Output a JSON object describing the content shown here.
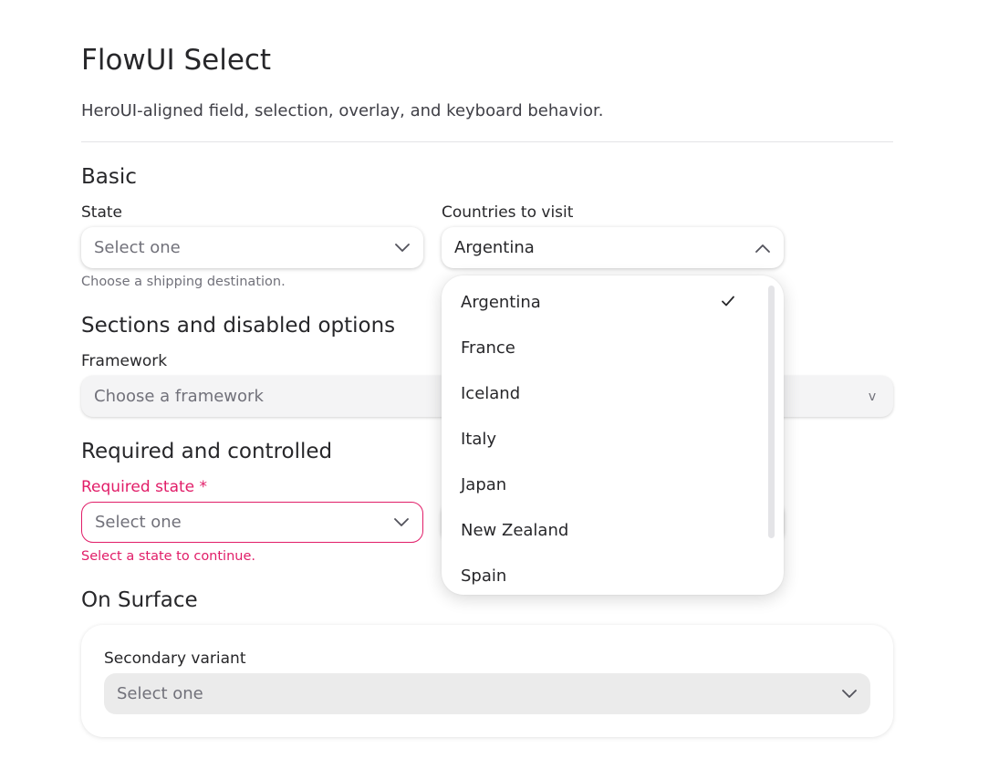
{
  "page": {
    "title": "FlowUI Select",
    "description": "HeroUI-aligned field, selection, overlay, and keyboard behavior."
  },
  "basic": {
    "heading": "Basic",
    "state": {
      "label": "State",
      "placeholder": "Select one",
      "help": "Choose a shipping destination."
    },
    "countries": {
      "label": "Countries to visit",
      "value": "Argentina",
      "open": true
    }
  },
  "sections": {
    "heading": "Sections and disabled options",
    "framework": {
      "label": "Framework",
      "placeholder": "Choose a framework",
      "chevron": "v"
    }
  },
  "required": {
    "heading": "Required and controlled",
    "state": {
      "label": "Required state",
      "asterisk": "*",
      "placeholder": "Select one",
      "error": "Select a state to continue."
    }
  },
  "surface": {
    "heading": "On Surface",
    "secondary": {
      "label": "Secondary variant",
      "placeholder": "Select one"
    }
  },
  "dropdown": {
    "options": [
      "Argentina",
      "France",
      "Iceland",
      "Italy",
      "Japan",
      "New Zealand",
      "Spain"
    ],
    "selected": "Argentina"
  },
  "colors": {
    "danger": "#e11d68",
    "text": "#27272a",
    "muted": "#71717a"
  }
}
